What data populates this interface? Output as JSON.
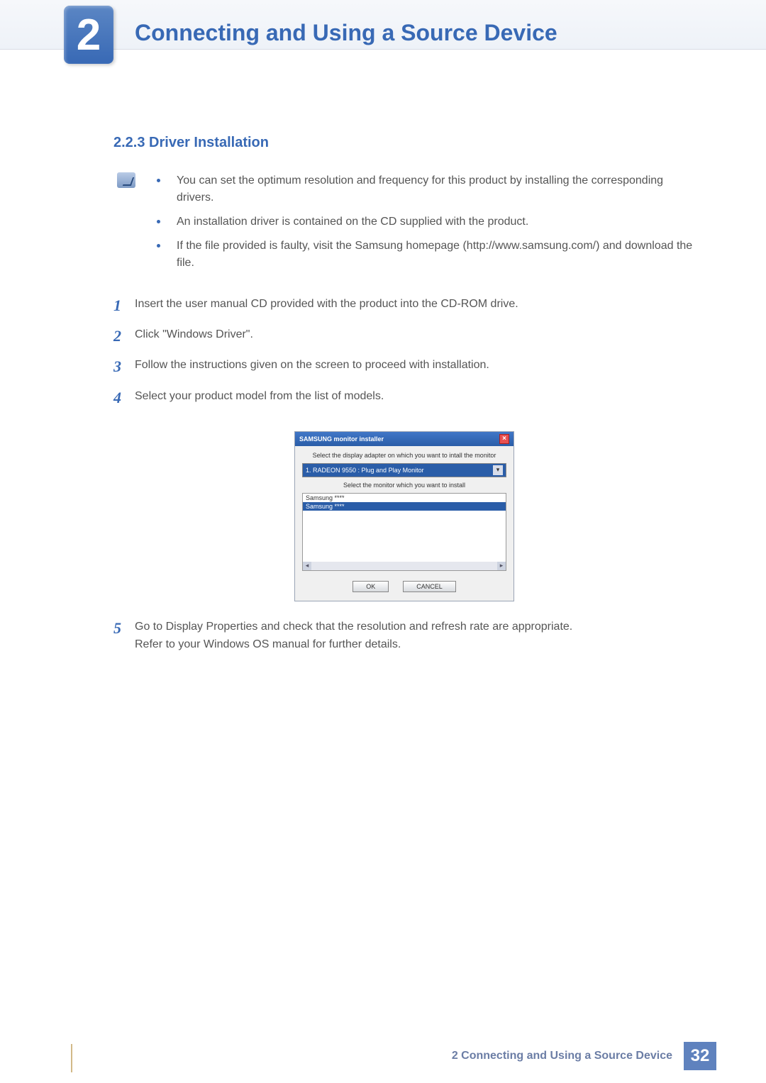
{
  "chapter": {
    "number": "2",
    "title": "Connecting and Using a Source Device"
  },
  "section": {
    "number_title": "2.2.3  Driver Installation"
  },
  "notes": [
    "You can set the optimum resolution and frequency for this product by installing the corresponding drivers.",
    "An installation driver is contained on the CD supplied with the product.",
    "If the file provided is faulty, visit the Samsung homepage (http://www.samsung.com/) and download the file."
  ],
  "steps": [
    {
      "n": "1",
      "text": "Insert the user manual CD provided with the product into the CD-ROM drive."
    },
    {
      "n": "2",
      "text": "Click \"Windows Driver\"."
    },
    {
      "n": "3",
      "text": "Follow the instructions given on the screen to proceed with installation."
    },
    {
      "n": "4",
      "text": "Select your product model from the list of models."
    },
    {
      "n": "5",
      "text": "Go to Display Properties and check that the resolution and refresh rate are appropriate."
    }
  ],
  "step5_extra": "Refer to your Windows OS manual for further details.",
  "dialog": {
    "title": "SAMSUNG monitor installer",
    "label1": "Select the display adapter on which you want to intall the monitor",
    "select_value": "1. RADEON 9550 : Plug and Play Monitor",
    "label2": "Select the monitor which you want to install",
    "list": [
      "Samsung ****",
      "Samsung ****"
    ],
    "ok": "OK",
    "cancel": "CANCEL"
  },
  "footer": {
    "text": "2 Connecting and Using a Source Device",
    "page": "32"
  }
}
